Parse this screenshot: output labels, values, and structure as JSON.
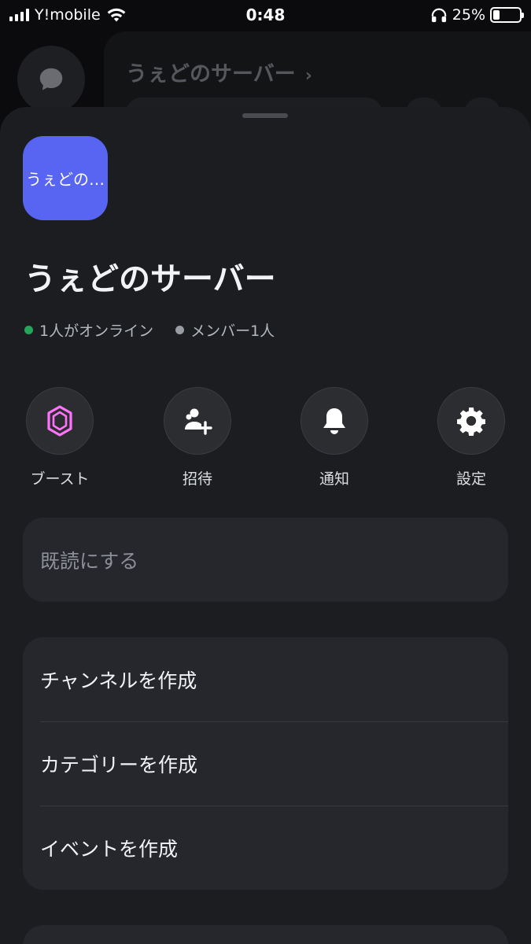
{
  "status_bar": {
    "carrier": "Y!mobile",
    "time": "0:48",
    "battery_percent": "25%",
    "battery_level": 0.25
  },
  "background": {
    "server_title": "うぇどのサーバー",
    "chevron": "›"
  },
  "sheet": {
    "server_icon_text": "うぇどの…",
    "server_name": "うぇどのサーバー",
    "online_text": "1人がオンライン",
    "members_text": "メンバー1人",
    "colors": {
      "online": "#23a55a",
      "members": "#9a9ca3",
      "accent": "#5865f2",
      "boost": "#ff73fa"
    },
    "actions": [
      {
        "label": "ブースト",
        "icon": "boost-gem-icon"
      },
      {
        "label": "招待",
        "icon": "invite-person-plus-icon"
      },
      {
        "label": "通知",
        "icon": "bell-icon"
      },
      {
        "label": "設定",
        "icon": "gear-icon"
      }
    ],
    "mark_read": "既読にする",
    "create_items": [
      "チャンネルを作成",
      "カテゴリーを作成",
      "イベントを作成"
    ]
  }
}
